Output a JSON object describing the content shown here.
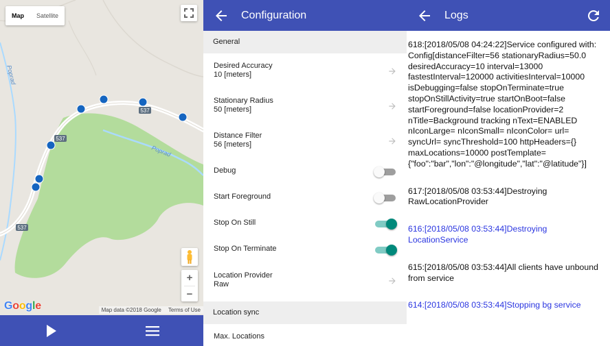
{
  "map": {
    "toggle": [
      "Map",
      "Satellite"
    ],
    "labels": {
      "river_left": "Poprad",
      "river_right": "Poprad",
      "road_1": "537",
      "road_2": "537",
      "road_3": "537"
    },
    "logo": [
      "G",
      "o",
      "o",
      "g",
      "l",
      "e"
    ],
    "logo_colors": [
      "#4285f4",
      "#ea4335",
      "#fbbc05",
      "#4285f4",
      "#34a853",
      "#ea4335"
    ],
    "zoom_in": "+",
    "zoom_out": "−",
    "attribution": {
      "data": "Map data ©2018 Google",
      "terms": "Terms of Use"
    },
    "colors": {
      "land": "#e9e6e0",
      "forest": "#b3dc9c",
      "road": "#ffffff",
      "river": "#aadaff",
      "marker": "#1565c0",
      "bar": "#3f51b5"
    },
    "icons": [
      "fullscreen-icon",
      "pegman-icon",
      "play-icon",
      "menu-icon"
    ]
  },
  "config": {
    "title": "Configuration",
    "sections": {
      "general": "General",
      "location_sync": "Location sync"
    },
    "rows": {
      "desired_accuracy": {
        "label": "Desired Accuracy",
        "value": "10 [meters]"
      },
      "stationary_radius": {
        "label": "Stationary Radius",
        "value": "50 [meters]"
      },
      "distance_filter": {
        "label": "Distance Filter",
        "value": "56 [meters]"
      },
      "debug": {
        "label": "Debug",
        "on": false
      },
      "start_foreground": {
        "label": "Start Foreground",
        "on": false
      },
      "stop_on_still": {
        "label": "Stop On Still",
        "on": true
      },
      "stop_on_terminate": {
        "label": "Stop On Terminate",
        "on": true
      },
      "location_provider": {
        "label": "Location Provider",
        "value": "Raw"
      },
      "max_locations": {
        "label": "Max. Locations"
      }
    },
    "colors": {
      "header": "#3f51b5",
      "accent": "#00897b"
    }
  },
  "logs": {
    "title": "Logs",
    "entries": [
      {
        "text": "618:[2018/05/08 04:24:22]Service configured with: Config[distanceFilter=56 stationaryRadius=50.0 desiredAccuracy=10 interval=13000 fastestInterval=120000 activitiesInterval=10000 isDebugging=false stopOnTerminate=true stopOnStillActivity=true startOnBoot=false startForeground=false locationProvider=2 nTitle=Background tracking nText=ENABLED nIconLarge= nIconSmall= nIconColor= url= syncUrl= syncThreshold=100 httpHeaders={} maxLocations=10000 postTemplate={\"foo\":\"bar\",\"lon\":\"@longitude\",\"lat\":\"@latitude\"}]",
        "color": "#111111"
      },
      {
        "text": "617:[2018/05/08 03:53:44]Destroying RawLocationProvider",
        "color": "#111111"
      },
      {
        "text": "616:[2018/05/08 03:53:44]Destroying LocationService",
        "color": "#2a35e0"
      },
      {
        "text": "615:[2018/05/08 03:53:44]All clients have unbound from service",
        "color": "#111111"
      },
      {
        "text": "614:[2018/05/08 03:53:44]Stopping bg service",
        "color": "#2a35e0"
      }
    ]
  }
}
